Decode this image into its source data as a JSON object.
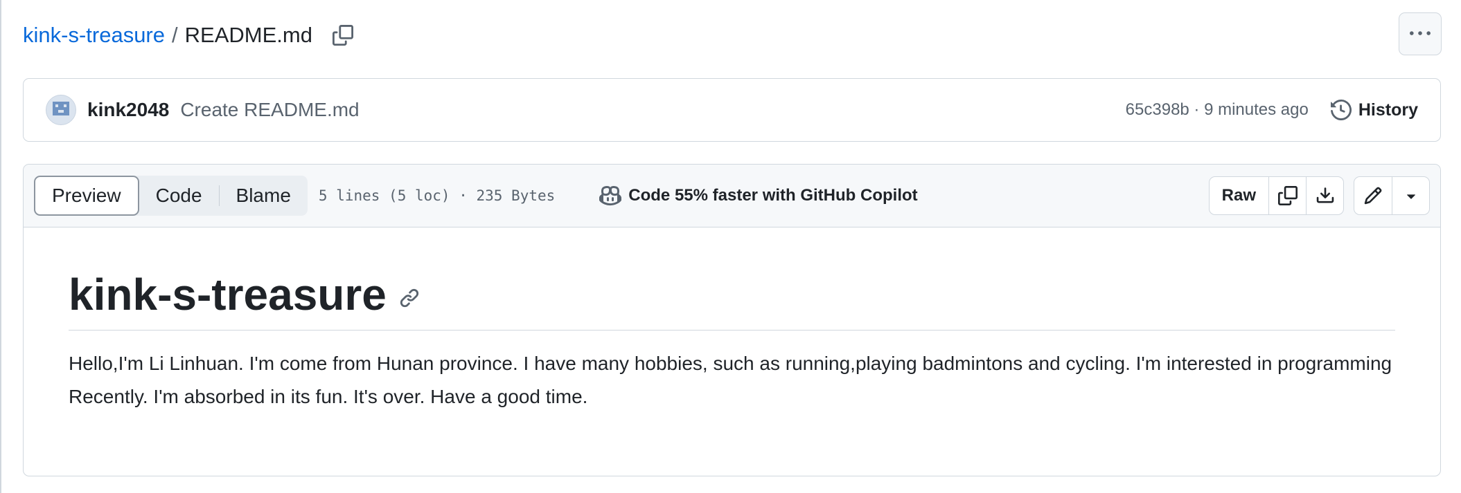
{
  "breadcrumb": {
    "repo": "kink-s-treasure",
    "separator": "/",
    "file": "README.md"
  },
  "commit": {
    "author": "kink2048",
    "message": "Create README.md",
    "meta": "65c398b · 9 minutes ago",
    "history_label": "History"
  },
  "file_header": {
    "tabs": [
      {
        "label": "Preview",
        "active": true
      },
      {
        "label": "Code",
        "active": false
      },
      {
        "label": "Blame",
        "active": false
      }
    ],
    "info": "5 lines (5 loc) · 235 Bytes",
    "copilot_text": "Code 55% faster with GitHub Copilot",
    "raw_label": "Raw"
  },
  "readme": {
    "title": "kink-s-treasure",
    "paragraph": "Hello,I'm Li Linhuan. I'm come from Hunan province. I have many hobbies, such as running,playing badmintons and cycling. I'm interested in programming Recently. I'm absorbed in its fun. It's over. Have a good time."
  },
  "colors": {
    "link": "#0969da",
    "text": "#1f2328",
    "muted": "#59636e",
    "border": "#d0d7de",
    "header_bg": "#f6f8fa"
  },
  "icons": [
    "copy-icon",
    "kebab-icon",
    "history-icon",
    "copilot-icon",
    "download-icon",
    "pencil-icon",
    "triangle-down-icon",
    "link-icon"
  ]
}
